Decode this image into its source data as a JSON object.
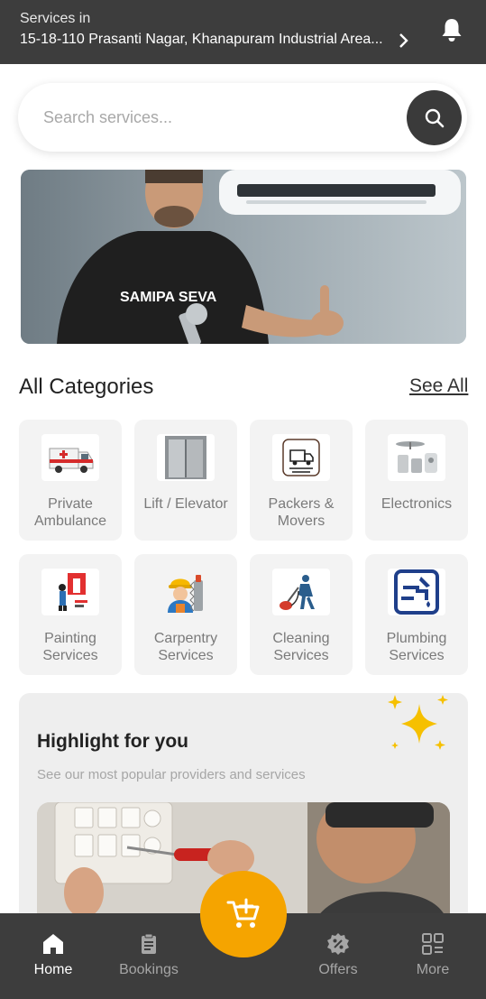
{
  "header": {
    "label": "Services in",
    "address": "15-18-110 Prasanti Nagar, Khanapuram Industrial Area..."
  },
  "search": {
    "placeholder": "Search services..."
  },
  "banner": {
    "shirt_text": "SAMIPA SEVA"
  },
  "categories": {
    "title": "All Categories",
    "see_all": "See All",
    "items": [
      {
        "label": "Private Ambulance",
        "icon": "ambulance-icon"
      },
      {
        "label": "Lift / Elevator",
        "icon": "elevator-icon"
      },
      {
        "label": "Packers & Movers",
        "icon": "packers-movers-icon"
      },
      {
        "label": "Electronics",
        "icon": "electronics-icon"
      },
      {
        "label": "Painting Services",
        "icon": "painting-icon"
      },
      {
        "label": "Carpentry Services",
        "icon": "carpentry-icon"
      },
      {
        "label": "Cleaning Services",
        "icon": "cleaning-icon"
      },
      {
        "label": "Plumbing Services",
        "icon": "plumbing-icon"
      }
    ]
  },
  "highlight": {
    "title": "Highlight for you",
    "subtitle": "See our most popular providers and services"
  },
  "nav": {
    "home": "Home",
    "bookings": "Bookings",
    "offers": "Offers",
    "more": "More"
  },
  "colors": {
    "header_bg": "#3d3d3d",
    "accent": "#f5a400",
    "card_bg": "#f3f3f3"
  }
}
